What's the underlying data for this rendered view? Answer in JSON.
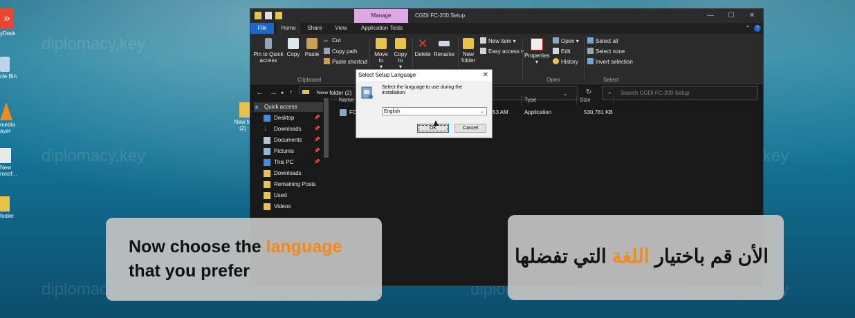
{
  "desktop": {
    "icons": [
      {
        "label": "yDesk",
        "icon": "anydesk-icon",
        "color": "#e8462e"
      },
      {
        "label": "cle Bin",
        "icon": "recycle-bin-icon",
        "color": "#bfd4e6"
      },
      {
        "label": "media ayer",
        "icon": "vlc-icon",
        "color": "#f08a1c"
      },
      {
        "label": "New rosof...",
        "icon": "document-icon",
        "color": "#e9e9e9"
      },
      {
        "label": "folder",
        "icon": "folder-icon",
        "color": "#e8c34a"
      }
    ],
    "overlap_folder_label": "New fo (2)"
  },
  "window": {
    "title": "CGDI FC-200 Setup",
    "manage_tab": "Manage",
    "tabs": [
      "File",
      "Home",
      "Share",
      "View",
      "Application Tools"
    ],
    "ribbon": {
      "clipboard": {
        "pin_label": "Pin to Quick access",
        "copy_label": "Copy",
        "paste_label": "Paste",
        "cut_label": "Cut",
        "copy_path_label": "Copy path",
        "paste_shortcut_label": "Paste shortcut",
        "group_label": "Clipboard"
      },
      "organize": {
        "move_to_label": "Move to",
        "copy_to_label": "Copy to",
        "delete_label": "Delete",
        "rename_label": "Rename"
      },
      "new": {
        "new_folder_label": "New folder",
        "new_item_label": "New item",
        "easy_access_label": "Easy access"
      },
      "open": {
        "properties_label": "Properties",
        "open_label": "Open",
        "edit_label": "Edit",
        "history_label": "History",
        "group_label": "Open"
      },
      "select": {
        "select_all_label": "Select all",
        "select_none_label": "Select none",
        "invert_label": "Invert selection",
        "group_label": "Select"
      }
    },
    "address_path": "New folder (2)",
    "search_placeholder": "Search CGDI FC-200 Setup",
    "nav": [
      {
        "label": "Quick access",
        "icon": "star-icon",
        "pinned": false
      },
      {
        "label": "Desktop",
        "icon": "desktop-icon",
        "pinned": true
      },
      {
        "label": "Downloads",
        "icon": "download-icon",
        "pinned": true
      },
      {
        "label": "Documents",
        "icon": "documents-icon",
        "pinned": true
      },
      {
        "label": "Pictures",
        "icon": "pictures-icon",
        "pinned": true
      },
      {
        "label": "This PC",
        "icon": "pc-icon",
        "pinned": true
      },
      {
        "label": "Downloads",
        "icon": "folder-icon",
        "pinned": false
      },
      {
        "label": "Remaining Posts",
        "icon": "folder-icon",
        "pinned": false
      },
      {
        "label": "Used",
        "icon": "folder-icon",
        "pinned": false
      },
      {
        "label": "Videos",
        "icon": "folder-icon",
        "pinned": false
      }
    ],
    "columns": {
      "name": "Name",
      "type": "Type",
      "size": "Size"
    },
    "file": {
      "name": "FC",
      "date": "53 AM",
      "type": "Application",
      "size": "530,781 KB"
    }
  },
  "dialog": {
    "title": "Select Setup Language",
    "message": "Select the language to use during the installation:",
    "selected_language": "English",
    "ok_label": "OK",
    "cancel_label": "Cancel"
  },
  "captions": {
    "english_line1_before": "Now choose the ",
    "english_highlight": "language",
    "english_line2": "that you prefer",
    "arabic_before": "الأن قم باختيار ",
    "arabic_highlight": "اللغة",
    "arabic_after": " التي تفضلها"
  },
  "watermark": "diplomacy.key",
  "colors": {
    "accent_blue": "#1b66c7",
    "manage_tab": "#e0a6e6",
    "caption_highlight": "#f28a1a"
  }
}
